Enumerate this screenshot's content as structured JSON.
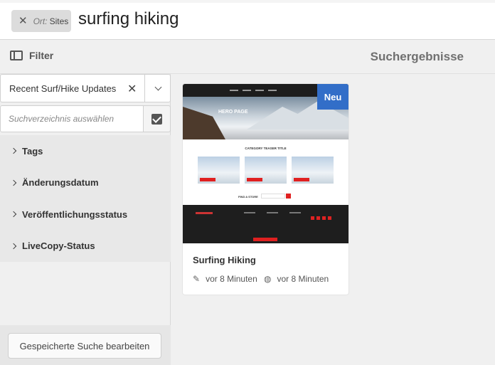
{
  "search": {
    "scope_tag": {
      "label": "Ort:",
      "value": "Sites"
    },
    "query": "surfing hiking"
  },
  "toolbar": {
    "filter_label": "Filter",
    "page_heading": "Suchergebnisse"
  },
  "sidebar": {
    "saved_search": {
      "value": "Recent Surf/Hike Updates"
    },
    "path_input": {
      "placeholder": "Suchverzeichnis auswählen"
    },
    "facets": [
      {
        "label": "Tags"
      },
      {
        "label": "Änderungsdatum"
      },
      {
        "label": "Veröffentlichungsstatus"
      },
      {
        "label": "LiveCopy-Status"
      }
    ],
    "edit_button_label": "Gespeicherte Suche bearbeiten"
  },
  "results": [
    {
      "title": "Surfing Hiking",
      "badge": "Neu",
      "thumbnail_text": {
        "hero": "HERO PAGE",
        "category": "CATEGORY TEASER TITLE",
        "find": "FIND A STORE"
      },
      "modified": "vor 8 Minuten",
      "published": "vor 8 Minuten"
    }
  ],
  "colors": {
    "badge_new": "#326ec8",
    "accent_red": "#e02020"
  },
  "icons": {
    "remove_tag": "close-icon",
    "filter": "filter-panel-icon",
    "clear": "close-icon",
    "dropdown": "chevron-down-icon",
    "confirm_path": "checkbox-icon",
    "facet": "chevron-right-icon",
    "modified": "pencil-icon",
    "published": "globe-icon"
  }
}
